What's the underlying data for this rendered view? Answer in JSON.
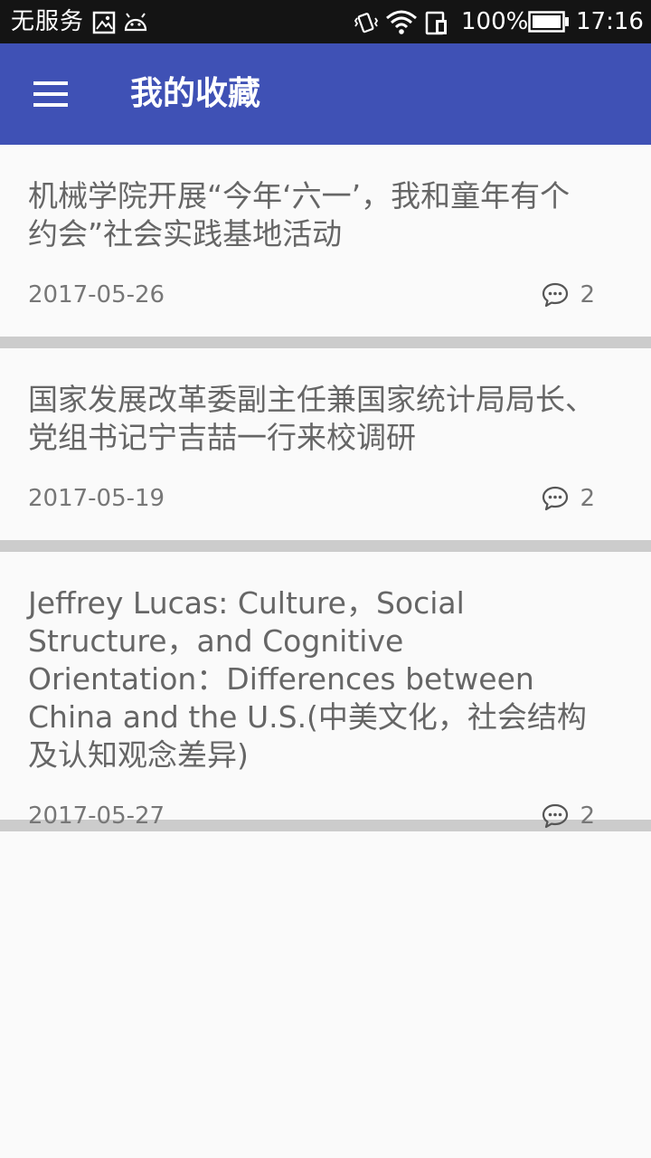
{
  "status_bar": {
    "carrier": "无服务",
    "battery": "100%",
    "time": "17:16"
  },
  "app_bar": {
    "title": "我的收藏",
    "menu_icon": "hamburger-menu-icon"
  },
  "favorites": [
    {
      "title": "机械学院开展“今年‘六一’，我和童年有个约会”社会实践基地活动",
      "date": "2017-05-26",
      "comments": "2"
    },
    {
      "title": "国家发展改革委副主任兼国家统计局局长、党组书记宁吉喆一行来校调研",
      "date": "2017-05-19",
      "comments": "2"
    },
    {
      "title": "Jeffrey Lucas: Culture，Social Structure，and Cognitive Orientation：Differences between China and the U.S.(中美文化，社会结构及认知观念差异)",
      "date": "2017-05-27",
      "comments": "2"
    }
  ],
  "colors": {
    "app_bar": "#3f51b5",
    "status_bar": "#141414",
    "background": "#fafafa",
    "separator": "#cccccc",
    "text": "#666666"
  }
}
